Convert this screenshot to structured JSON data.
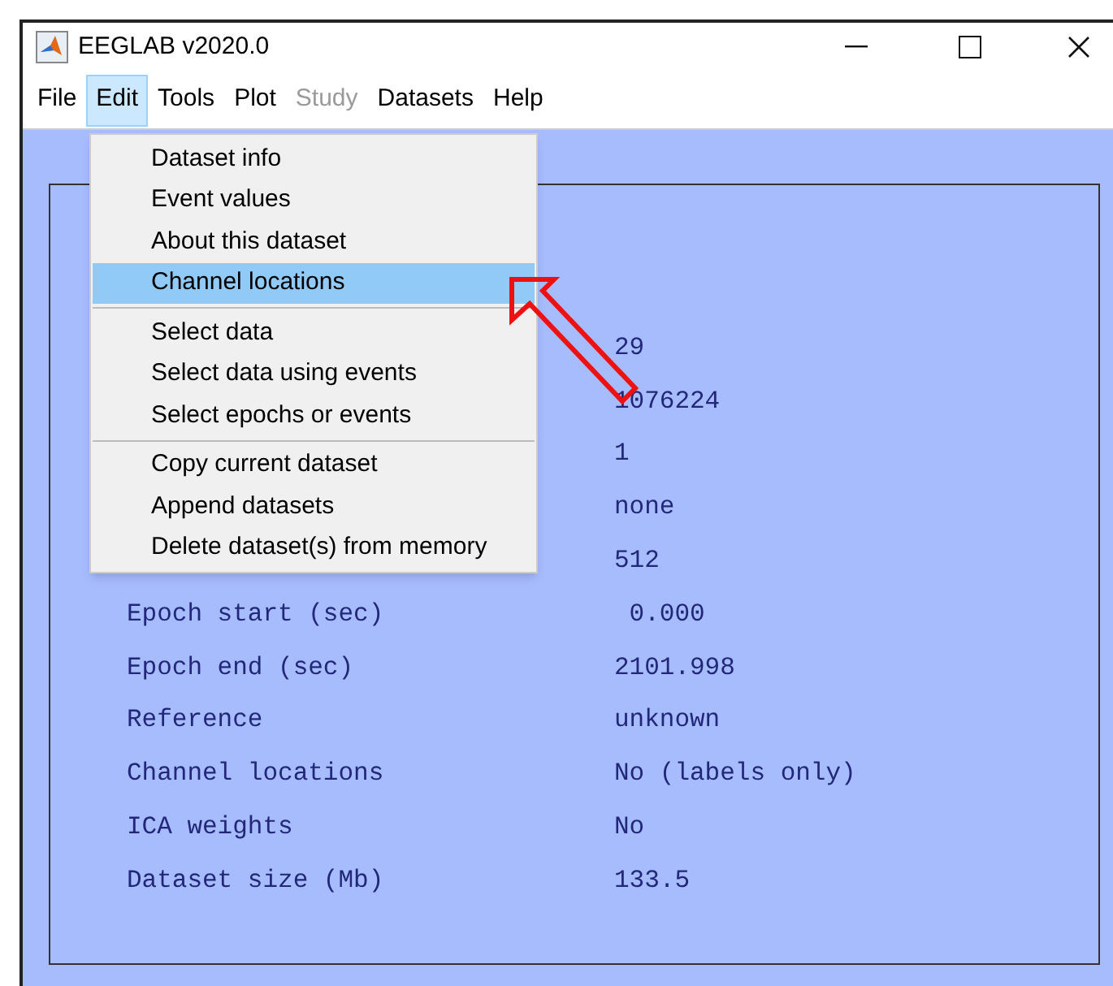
{
  "window": {
    "title": "EEGLAB v2020.0"
  },
  "menubar": [
    {
      "label": "File",
      "selected": false,
      "disabled": false
    },
    {
      "label": "Edit",
      "selected": true,
      "disabled": false
    },
    {
      "label": "Tools",
      "selected": false,
      "disabled": false
    },
    {
      "label": "Plot",
      "selected": false,
      "disabled": false
    },
    {
      "label": "Study",
      "selected": false,
      "disabled": true
    },
    {
      "label": "Datasets",
      "selected": false,
      "disabled": false
    },
    {
      "label": "Help",
      "selected": false,
      "disabled": false
    }
  ],
  "edit_menu": [
    [
      {
        "label": "Dataset info",
        "selected": false
      },
      {
        "label": "Event values",
        "selected": false
      },
      {
        "label": "About this dataset",
        "selected": false
      },
      {
        "label": "Channel locations",
        "selected": true
      }
    ],
    [
      {
        "label": "Select data",
        "selected": false
      },
      {
        "label": "Select data using events",
        "selected": false
      },
      {
        "label": "Select epochs or events",
        "selected": false
      }
    ],
    [
      {
        "label": "Copy current dataset",
        "selected": false
      },
      {
        "label": "Append datasets",
        "selected": false
      },
      {
        "label": "Delete dataset(s) from memory",
        "selected": false
      }
    ]
  ],
  "dataset_info": [
    {
      "value": "29"
    },
    {
      "value": "1076224"
    },
    {
      "value": "1"
    },
    {
      "value": "none"
    },
    {
      "value": "512"
    },
    {
      "label": "Epoch start (sec)",
      "value": " 0.000"
    },
    {
      "label": "Epoch end (sec)",
      "value": "2101.998"
    },
    {
      "label": "Reference",
      "value": "unknown"
    },
    {
      "label": "Channel locations",
      "value": "No (labels only)"
    },
    {
      "label": "ICA weights",
      "value": "No"
    },
    {
      "label": "Dataset size (Mb)",
      "value": "133.5"
    }
  ]
}
